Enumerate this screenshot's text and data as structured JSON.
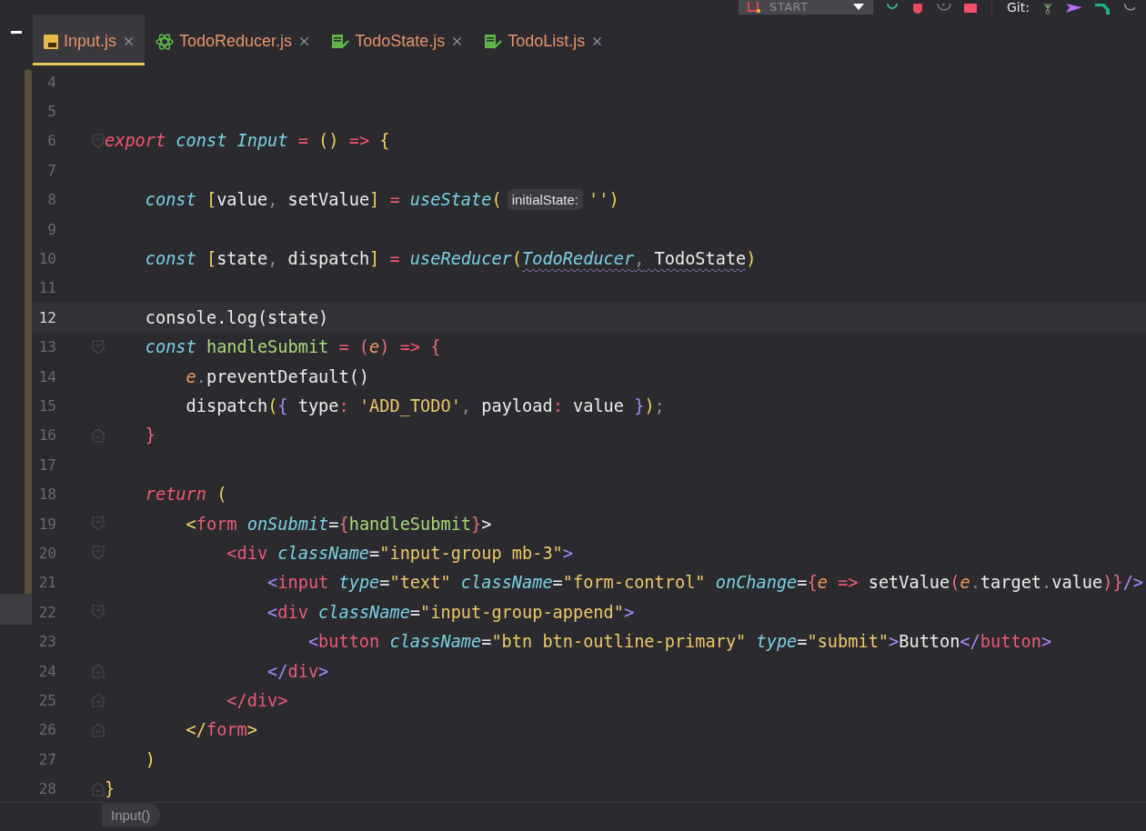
{
  "toolbar": {
    "run_config": "START",
    "git_label": "Git:"
  },
  "tabs": [
    {
      "label": "Input.js",
      "kind": "js",
      "selected": true
    },
    {
      "label": "TodoReducer.js",
      "kind": "reducer",
      "selected": false
    },
    {
      "label": "TodoState.js",
      "kind": "state",
      "selected": false
    },
    {
      "label": "TodoList.js",
      "kind": "state",
      "selected": false
    }
  ],
  "lines": [
    {
      "number": "4",
      "current": false
    },
    {
      "number": "5",
      "current": false
    },
    {
      "number": "6",
      "current": false,
      "fold_start": true,
      "tokens": [
        {
          "text": "export",
          "kind": "kw"
        },
        {
          "text": " const",
          "kind": "decl"
        },
        {
          "text": " Input",
          "kind": "fn"
        },
        {
          "text": " =",
          "kind": "op"
        },
        {
          "text": " ()",
          "kind": "brace"
        },
        {
          "text": " =>",
          "kind": "op"
        },
        {
          "text": " {",
          "kind": "brace"
        }
      ]
    },
    {
      "number": "7",
      "current": false
    },
    {
      "number": "8",
      "current": false,
      "tokens": [
        {
          "text": "    const",
          "kind": "decl"
        },
        {
          "text": " [",
          "kind": "brace"
        },
        {
          "text": "value",
          "kind": "plain"
        },
        {
          "text": ",",
          "kind": "punct"
        },
        {
          "text": " setValue",
          "kind": "plain"
        },
        {
          "text": "]",
          "kind": "brace"
        },
        {
          "text": " =",
          "kind": "op"
        },
        {
          "text": " useState",
          "kind": "fn"
        },
        {
          "text": "(",
          "kind": "brace"
        },
        {
          "text": "initialState:",
          "kind": "hint"
        },
        {
          "text": "''",
          "kind": "str"
        },
        {
          "text": ")",
          "kind": "brace"
        }
      ]
    },
    {
      "number": "9",
      "current": false
    },
    {
      "number": "10",
      "current": false,
      "tokens": [
        {
          "text": "    const",
          "kind": "decl"
        },
        {
          "text": " [",
          "kind": "brace"
        },
        {
          "text": "state",
          "kind": "plain"
        },
        {
          "text": ",",
          "kind": "punct"
        },
        {
          "text": " dispatch",
          "kind": "plain"
        },
        {
          "text": "]",
          "kind": "brace"
        },
        {
          "text": " =",
          "kind": "op"
        },
        {
          "text": " useReducer",
          "kind": "fn"
        },
        {
          "text": "(",
          "kind": "brace"
        },
        {
          "text": "TodoReducer",
          "kind": "fn",
          "warning": true
        },
        {
          "text": ",",
          "kind": "punct",
          "warning": true
        },
        {
          "text": " TodoState",
          "kind": "plain",
          "warning": true
        },
        {
          "text": ")",
          "kind": "brace"
        }
      ]
    },
    {
      "number": "11",
      "current": false
    },
    {
      "number": "12",
      "current": true,
      "tokens": [
        {
          "text": "    console.log(state)",
          "kind": "plain"
        }
      ]
    },
    {
      "number": "13",
      "current": false,
      "fold_start": true,
      "tokens": [
        {
          "text": "    const",
          "kind": "decl"
        },
        {
          "text": " handleSubmit",
          "kind": "green"
        },
        {
          "text": " =",
          "kind": "op"
        },
        {
          "text": " (",
          "kind": "pbrace"
        },
        {
          "text": "e",
          "kind": "param"
        },
        {
          "text": ")",
          "kind": "pbrace"
        },
        {
          "text": " =>",
          "kind": "op"
        },
        {
          "text": " {",
          "kind": "pbrace"
        }
      ]
    },
    {
      "number": "14",
      "current": false,
      "tokens": [
        {
          "text": "        e",
          "kind": "param"
        },
        {
          "text": ".",
          "kind": "punct"
        },
        {
          "text": "preventDefault()",
          "kind": "plain"
        }
      ]
    },
    {
      "number": "15",
      "current": false,
      "tokens": [
        {
          "text": "        dispatch",
          "kind": "plain"
        },
        {
          "text": "(",
          "kind": "brace"
        },
        {
          "text": "{",
          "kind": "vbrace"
        },
        {
          "text": " type",
          "kind": "plain"
        },
        {
          "text": ":",
          "kind": "op"
        },
        {
          "text": " 'ADD_TODO'",
          "kind": "str"
        },
        {
          "text": ",",
          "kind": "punct"
        },
        {
          "text": " payload",
          "kind": "plain"
        },
        {
          "text": ":",
          "kind": "op"
        },
        {
          "text": " value",
          "kind": "plain"
        },
        {
          "text": " }",
          "kind": "vbrace"
        },
        {
          "text": ")",
          "kind": "brace"
        },
        {
          "text": ";",
          "kind": "punct"
        }
      ]
    },
    {
      "number": "16",
      "current": false,
      "fold_end": true,
      "tokens": [
        {
          "text": "    }",
          "kind": "pbrace"
        }
      ]
    },
    {
      "number": "17",
      "current": false
    },
    {
      "number": "18",
      "current": false,
      "tokens": [
        {
          "text": "    return",
          "kind": "kw"
        },
        {
          "text": " (",
          "kind": "brace"
        }
      ]
    },
    {
      "number": "19",
      "current": false,
      "fold_start": true,
      "tokens": [
        {
          "text": "        <",
          "kind": "brace"
        },
        {
          "text": "form",
          "kind": "tag"
        },
        {
          "text": " onSubmit",
          "kind": "attr"
        },
        {
          "text": "=",
          "kind": "plain"
        },
        {
          "text": "{",
          "kind": "pbrace"
        },
        {
          "text": "handleSubmit",
          "kind": "green"
        },
        {
          "text": "}",
          "kind": "pbrace"
        },
        {
          "text": ">",
          "kind": "plain"
        }
      ]
    },
    {
      "number": "20",
      "current": false,
      "fold_start": true,
      "tokens": [
        {
          "text": "            <div",
          "kind": "tag"
        },
        {
          "text": " className",
          "kind": "attr"
        },
        {
          "text": "=",
          "kind": "plain"
        },
        {
          "text": "\"input-group mb-3\"",
          "kind": "str"
        },
        {
          "text": ">",
          "kind": "angle"
        }
      ]
    },
    {
      "number": "21",
      "current": false,
      "tokens": [
        {
          "text": "                <",
          "kind": "angle"
        },
        {
          "text": "input",
          "kind": "tag"
        },
        {
          "text": " type",
          "kind": "attr"
        },
        {
          "text": "=",
          "kind": "plain"
        },
        {
          "text": "\"text\"",
          "kind": "str"
        },
        {
          "text": " className",
          "kind": "attr"
        },
        {
          "text": "=",
          "kind": "plain"
        },
        {
          "text": "\"form-control\"",
          "kind": "str"
        },
        {
          "text": " onChange",
          "kind": "attr"
        },
        {
          "text": "=",
          "kind": "plain"
        },
        {
          "text": "{",
          "kind": "pbrace"
        },
        {
          "text": "e",
          "kind": "param"
        },
        {
          "text": " =>",
          "kind": "op"
        },
        {
          "text": " setValue",
          "kind": "plain"
        },
        {
          "text": "(",
          "kind": "pbrace"
        },
        {
          "text": "e",
          "kind": "param"
        },
        {
          "text": ".",
          "kind": "punct"
        },
        {
          "text": "target",
          "kind": "plain"
        },
        {
          "text": ".",
          "kind": "punct"
        },
        {
          "text": "value",
          "kind": "plain"
        },
        {
          "text": ")",
          "kind": "pbrace"
        },
        {
          "text": "}",
          "kind": "pbrace"
        },
        {
          "text": "/>",
          "kind": "angle"
        }
      ]
    },
    {
      "number": "22",
      "current": false,
      "fold_start": true,
      "tokens": [
        {
          "text": "                <",
          "kind": "angle"
        },
        {
          "text": "div",
          "kind": "tag"
        },
        {
          "text": " className",
          "kind": "attr"
        },
        {
          "text": "=",
          "kind": "plain"
        },
        {
          "text": "\"input-group-append\"",
          "kind": "str"
        },
        {
          "text": ">",
          "kind": "angle"
        }
      ]
    },
    {
      "number": "23",
      "current": false,
      "tokens": [
        {
          "text": "                    <",
          "kind": "angle"
        },
        {
          "text": "button",
          "kind": "tag"
        },
        {
          "text": " className",
          "kind": "attr"
        },
        {
          "text": "=",
          "kind": "plain"
        },
        {
          "text": "\"btn btn-outline-primary\"",
          "kind": "str"
        },
        {
          "text": " type",
          "kind": "attr"
        },
        {
          "text": "=",
          "kind": "plain"
        },
        {
          "text": "\"submit\"",
          "kind": "str"
        },
        {
          "text": ">",
          "kind": "angle"
        },
        {
          "text": "Button",
          "kind": "plain"
        },
        {
          "text": "</",
          "kind": "angle"
        },
        {
          "text": "button",
          "kind": "tag"
        },
        {
          "text": ">",
          "kind": "angle"
        }
      ]
    },
    {
      "number": "24",
      "current": false,
      "fold_end": true,
      "tokens": [
        {
          "text": "                </",
          "kind": "angle"
        },
        {
          "text": "div",
          "kind": "tag"
        },
        {
          "text": ">",
          "kind": "angle"
        }
      ]
    },
    {
      "number": "25",
      "current": false,
      "fold_end": true,
      "tokens": [
        {
          "text": "            </div>",
          "kind": "tag"
        }
      ]
    },
    {
      "number": "26",
      "current": false,
      "fold_end": true,
      "tokens": [
        {
          "text": "        </",
          "kind": "brace"
        },
        {
          "text": "form",
          "kind": "tag"
        },
        {
          "text": ">",
          "kind": "brace"
        }
      ]
    },
    {
      "number": "27",
      "current": false,
      "tokens": [
        {
          "text": "    )",
          "kind": "brace"
        }
      ]
    },
    {
      "number": "28",
      "current": false,
      "fold_end": true,
      "tokens": [
        {
          "text": "}",
          "kind": "brace"
        }
      ]
    }
  ],
  "breadcrumb": [
    "Input()"
  ]
}
